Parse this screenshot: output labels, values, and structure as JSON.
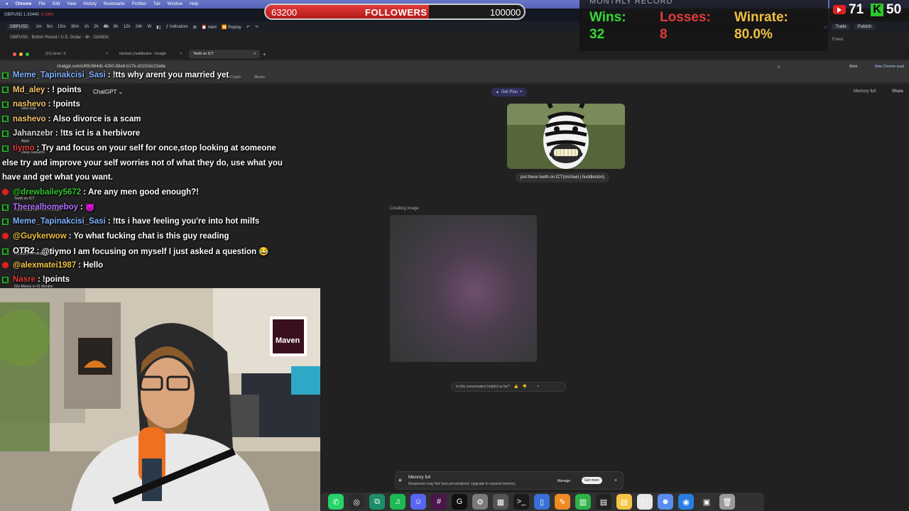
{
  "menubar": {
    "app": "Chrome",
    "items": [
      "File",
      "Edit",
      "View",
      "History",
      "Bookmarks",
      "Profiles",
      "Tab",
      "Window",
      "Help"
    ]
  },
  "tradingview": {
    "symbol": "GBPUSD",
    "price": "1.33440",
    "change": "-0.16%",
    "intervals": [
      "1m",
      "5m",
      "15m",
      "30m",
      "1h",
      "2h",
      "4h",
      "8h",
      "12h",
      "24h",
      "W"
    ],
    "active_interval": "4h",
    "indicators_label": "Indicators",
    "alert_label": "Alert",
    "replay_label": "Replay",
    "info_line": "GBPUSD · British Pound / U.S. Dollar · 4h · OANDA",
    "trade_label": "Trade",
    "publish_label": "Publish",
    "forex_label": "Forex"
  },
  "browser": {
    "tabs": [
      {
        "title": "(21) Grok / X",
        "active": false
      },
      {
        "title": "michael j huddleston - Google",
        "active": false
      },
      {
        "title": "Teeth on ICT",
        "active": true
      }
    ],
    "url": "chatgpt.com/c/69c564d1-4250-83e8-b17b-d2151bc23a6e",
    "bookmarks": [
      "WenCrypto",
      "Maven"
    ],
    "profile_label": "Work",
    "new_chrome_label": "New Chrome avail"
  },
  "chatgpt": {
    "title": "ChatGPT",
    "get_plus": "Get Plus",
    "memory_full_top": "Memory full",
    "share": "Share",
    "user_message": "put these teeth on ICT(michael j huddleston)",
    "creating_label": "Creating image",
    "feedback_question": "Is this conversation helpful so far?",
    "memory_banner": {
      "title": "Memory full",
      "description": "Responses may feel less personalized. Upgrade to expand memory,",
      "manage": "Manage",
      "get_more": "Get more"
    },
    "sidebar_fragments": [
      "New chat",
      "Apps",
      "Deep research",
      "Teeth on ICT",
      "Profit Odds with 49% Winrate",
      "Kundalini vs meditation",
      "Best Moon of Cancel",
      "50x Money in 41 Months"
    ]
  },
  "stream": {
    "followers": {
      "label": "FOLLOWERS",
      "current": "63200",
      "goal": "100000",
      "progress": 0.632
    },
    "record": {
      "title": "MONTHLY RECORD",
      "wins_label": "Wins:",
      "wins": "32",
      "losses_label": "Losses:",
      "losses": "8",
      "winrate_label": "Winrate:",
      "winrate": "80.0%"
    },
    "youtube_viewers": "71",
    "kick_viewers": "50",
    "colors": {
      "wins": "#35d935",
      "losses": "#e23a3a",
      "winrate": "#f0c040",
      "kick": "#2ec62e",
      "youtube": "#e02020"
    }
  },
  "chat": [
    {
      "platform": "kick",
      "user": "Meme_Tapinakcisi_Sasi",
      "user_color": "#7fb2ff",
      "message": "!tts why arent you married yet"
    },
    {
      "platform": "kick",
      "user": "Md_aley",
      "user_color": "#f5c26b",
      "message": "! points"
    },
    {
      "platform": "kick",
      "user": "nashevo",
      "user_color": "#f5c26b",
      "message": "!points"
    },
    {
      "platform": "kick",
      "user": "nashevo",
      "user_color": "#f5c26b",
      "message": "Also divorce is a scam"
    },
    {
      "platform": "kick",
      "user": "Jahanzebr",
      "user_color": "#d8d8d8",
      "message": "!tts ict is a herbivore"
    },
    {
      "platform": "kick",
      "user": "tiymo",
      "user_color": "#e23a3a",
      "message": "Try and focus on your self for once,stop looking at someone"
    },
    {
      "platform": "none",
      "user": "",
      "user_color": "#ffffff",
      "message": "else try and improve your self worries not of what they do, use what you"
    },
    {
      "platform": "none",
      "user": "",
      "user_color": "#ffffff",
      "message": "have and get what you want."
    },
    {
      "platform": "yt",
      "user": "@drewbailey5672",
      "user_color": "#2ec62e",
      "message": "Are any men good enough?!"
    },
    {
      "platform": "kick",
      "user": "Therealhomeboy",
      "user_color": "#b070ff",
      "message": "😈"
    },
    {
      "platform": "kick",
      "user": "Meme_Tapinakcisi_Sasi",
      "user_color": "#7fb2ff",
      "message": "!tts i have feeling you're into hot milfs"
    },
    {
      "platform": "yt",
      "user": "@Guykerwow",
      "user_color": "#f0c040",
      "message": "Yo what fucking chat is this guy reading"
    },
    {
      "platform": "kick",
      "user": "OTR2",
      "user_color": "#ffffff",
      "message": "@tiymo I am focusing on myself I just asked a question 😂"
    },
    {
      "platform": "yt",
      "user": "@alexmatei1987",
      "user_color": "#f0c040",
      "message": "Hello"
    },
    {
      "platform": "kick",
      "user": "Nasre",
      "user_color": "#e23a3a",
      "message": "!points"
    }
  ],
  "webcam": {
    "sign_text": "Maven"
  },
  "dock": [
    {
      "name": "whatsapp",
      "color": "#25d366",
      "glyph": "✆"
    },
    {
      "name": "openai",
      "color": "#2b2b2b",
      "glyph": "◎"
    },
    {
      "name": "copilot",
      "color": "#1b8f6a",
      "glyph": "⧉"
    },
    {
      "name": "spotify",
      "color": "#1db954",
      "glyph": "♫"
    },
    {
      "name": "discord",
      "color": "#5865f2",
      "glyph": "☺"
    },
    {
      "name": "slack",
      "color": "#4a154b",
      "glyph": "#"
    },
    {
      "name": "logitech",
      "color": "#111111",
      "glyph": "G"
    },
    {
      "name": "settings",
      "color": "#7a7a7a",
      "glyph": "⚙"
    },
    {
      "name": "calculator",
      "color": "#555555",
      "glyph": "▦"
    },
    {
      "name": "terminal",
      "color": "#1a1a1a",
      "glyph": ">_"
    },
    {
      "name": "files",
      "color": "#3a6fd8",
      "glyph": "▯"
    },
    {
      "name": "pages",
      "color": "#f08a24",
      "glyph": "✎"
    },
    {
      "name": "numbers",
      "color": "#2db34a",
      "glyph": "▥"
    },
    {
      "name": "activity",
      "color": "#222222",
      "glyph": "▤"
    },
    {
      "name": "notes",
      "color": "#f5c542",
      "glyph": "▤"
    },
    {
      "name": "preview",
      "color": "#e8e8e8",
      "glyph": "▢"
    },
    {
      "name": "finder",
      "color": "#5a8df0",
      "glyph": "☻"
    },
    {
      "name": "safari",
      "color": "#2a7de1",
      "glyph": "◉"
    },
    {
      "name": "photo",
      "color": "#333333",
      "glyph": "▣"
    },
    {
      "name": "trash",
      "color": "#9a9a9a",
      "glyph": "🗑"
    }
  ]
}
